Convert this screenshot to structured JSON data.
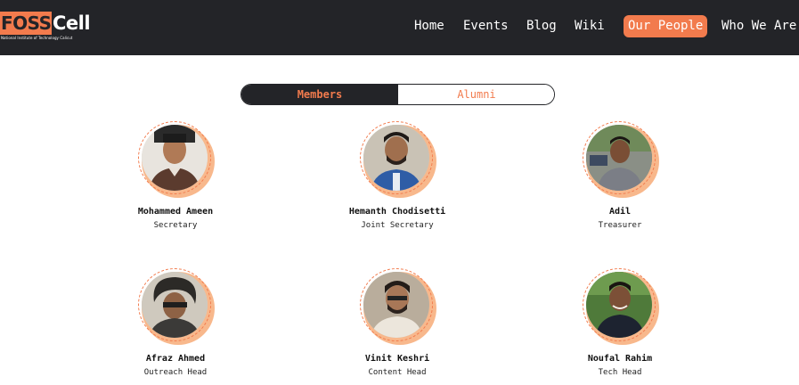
{
  "brand": {
    "name_part1": "FOSS",
    "name_part2": "Cell",
    "tagline": "National Institute of Technology Calicut"
  },
  "nav": {
    "items": [
      {
        "label": "Home"
      },
      {
        "label": "Events"
      },
      {
        "label": "Blog"
      },
      {
        "label": "Wiki"
      },
      {
        "label": "Our People",
        "active": true
      },
      {
        "label": "Who We Are"
      }
    ]
  },
  "toggle": {
    "members_label": "Members",
    "alumni_label": "Alumni",
    "selected": "Members"
  },
  "members": [
    {
      "name": "Mohammed Ameen",
      "role": "Secretary"
    },
    {
      "name": "Hemanth Chodisetti",
      "role": "Joint Secretary"
    },
    {
      "name": "Adil",
      "role": "Treasurer"
    },
    {
      "name": "Afraz Ahmed",
      "role": "Outreach Head"
    },
    {
      "name": "Vinit Keshri",
      "role": "Content Head"
    },
    {
      "name": "Noufal Rahim",
      "role": "Tech Head"
    }
  ],
  "colors": {
    "navbar_bg": "#232428",
    "accent": "#f27b4d",
    "avatar_shadow": "#f8b88c"
  }
}
